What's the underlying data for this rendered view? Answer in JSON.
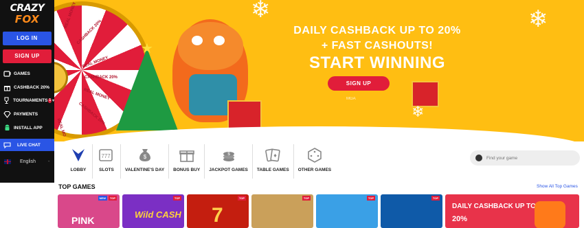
{
  "brand": {
    "logo_line1": "CRAZY",
    "logo_line2": "FOX"
  },
  "sidebar": {
    "login_label": "LOG IN",
    "signup_label": "SIGN UP",
    "items": [
      {
        "label": "GAMES",
        "icon": "slot-machine-icon"
      },
      {
        "label": "CASHBACK 20%",
        "icon": "gift-icon"
      },
      {
        "label": "TOURNAMENTS",
        "icon": "trophy-icon",
        "badge": "1"
      },
      {
        "label": "PAYMENTS",
        "icon": "diamond-icon"
      },
      {
        "label": "INSTALL APP",
        "icon": "android-icon"
      }
    ],
    "live_chat_label": "LIVE CHAT",
    "language": "English",
    "language_dash": "-"
  },
  "banner": {
    "line1": "DAILY CASHBACK UP TO 20%",
    "line2": "+ FAST CASHOUTS!",
    "line3": "START WINNING",
    "cta_label": "SIGN UP",
    "license": "MGA",
    "wheel_labels": [
      "REAL MONEY",
      "CASHBACK 20%",
      "REAL MONEY",
      "CASHBACK 20%",
      "REAL MONEY",
      "CASHBACK 20%",
      "REAL MO"
    ]
  },
  "categories": [
    {
      "label": "LOBBY",
      "icon": "lobby-icon"
    },
    {
      "label": "SLOTS",
      "icon": "slots-icon"
    },
    {
      "label": "VALENTINE'S DAY",
      "icon": "money-bag-icon"
    },
    {
      "label": "BONUS BUY",
      "icon": "gift-icon"
    },
    {
      "label": "JACKPOT GAMES",
      "icon": "jackpot-icon"
    },
    {
      "label": "TABLE GAMES",
      "icon": "cards-icon"
    },
    {
      "label": "OTHER GAMES",
      "icon": "dice-icon"
    }
  ],
  "search": {
    "placeholder": "Find your game"
  },
  "top_games": {
    "title": "TOP GAMES",
    "show_all": "Show All Top Games",
    "tiles": [
      {
        "name": "PINK",
        "tag": "TOP",
        "tag2": "NEW",
        "color": "#d9488a"
      },
      {
        "name": "Wild CASH",
        "tag": "TOP",
        "color": "#7b2fc4"
      },
      {
        "name": "7",
        "tag": "TOP",
        "color": "#c41e0f"
      },
      {
        "name": "",
        "tag": "TOP",
        "color": "#caa05a"
      },
      {
        "name": "",
        "tag": "TOP",
        "color": "#3aa0e6"
      },
      {
        "name": "",
        "tag": "TOP",
        "color": "#0f5aa8"
      }
    ],
    "promo_line1": "DAILY CASHBACK UP TO",
    "promo_line2": "20%"
  },
  "colors": {
    "accent_blue": "#2a55e5",
    "accent_red": "#e11d3a",
    "banner_yellow": "#ffbe12",
    "sidebar_bg": "#111111"
  }
}
